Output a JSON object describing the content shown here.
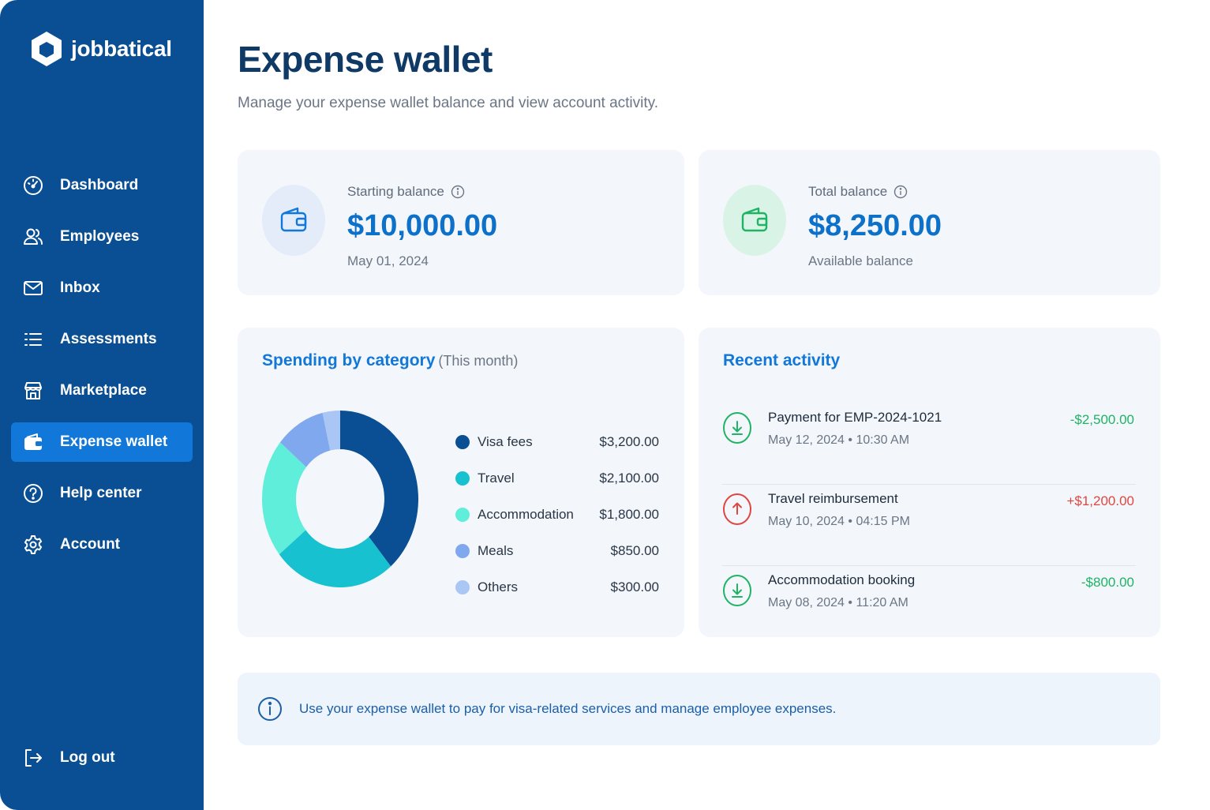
{
  "brand": {
    "name": "jobbatical"
  },
  "sidebar": {
    "items": [
      {
        "label": "Dashboard",
        "icon": "gauge-icon",
        "active": false
      },
      {
        "label": "Employees",
        "icon": "users-icon",
        "active": false
      },
      {
        "label": "Inbox",
        "icon": "mail-icon",
        "active": false
      },
      {
        "label": "Assessments",
        "icon": "list-icon",
        "active": false
      },
      {
        "label": "Marketplace",
        "icon": "store-icon",
        "active": false
      },
      {
        "label": "Expense wallet",
        "icon": "wallet-icon",
        "active": true
      },
      {
        "label": "Help center",
        "icon": "help-icon",
        "active": false
      },
      {
        "label": "Account",
        "icon": "gear-icon",
        "active": false
      }
    ],
    "logout_label": "Log out"
  },
  "header": {
    "title": "Expense wallet",
    "subtitle": "Manage your expense wallet balance and view account activity."
  },
  "balances": {
    "starting": {
      "label": "Starting balance",
      "amount": "$10,000.00",
      "sub": "May 01, 2024"
    },
    "total": {
      "label": "Total balance",
      "amount": "$8,250.00",
      "sub": "Available balance"
    }
  },
  "spending": {
    "title": "Spending by category",
    "period": "(This month)"
  },
  "chart_data": {
    "type": "pie",
    "donut": true,
    "categories": [
      "Visa fees",
      "Travel",
      "Accommodation",
      "Meals",
      "Others"
    ],
    "values": [
      3200,
      2100,
      1800,
      850,
      300
    ],
    "value_labels": [
      "$3,200.00",
      "$2,100.00",
      "$1,800.00",
      "$850.00",
      "$300.00"
    ],
    "colors": [
      "#0a4f93",
      "#17c1cf",
      "#5eeed9",
      "#7fa8ee",
      "#a9c6f4"
    ],
    "legend_position": "right"
  },
  "activity": {
    "title": "Recent activity",
    "items": [
      {
        "title": "Payment for EMP-2024-1021",
        "date": "May 12, 2024",
        "time": "10:30 AM",
        "amount": "-$2,500.00",
        "direction": "down",
        "icon": "download-circle-icon"
      },
      {
        "title": "Travel reimbursement",
        "date": "May 10, 2024",
        "time": "04:15 PM",
        "amount": "+$1,200.00",
        "direction": "up",
        "icon": "upload-circle-icon"
      },
      {
        "title": "Accommodation booking",
        "date": "May 08, 2024",
        "time": "11:20 AM",
        "amount": "-$800.00",
        "direction": "down",
        "icon": "download-circle-icon"
      }
    ]
  },
  "info": {
    "text": "Use your expense wallet to pay for visa-related services and manage employee expenses."
  },
  "colors": {
    "sidebar": "#0a4f93",
    "active": "#1177d9",
    "accent": "#0d70c9",
    "positive": "#1fb364",
    "negative": "#e0463f"
  }
}
